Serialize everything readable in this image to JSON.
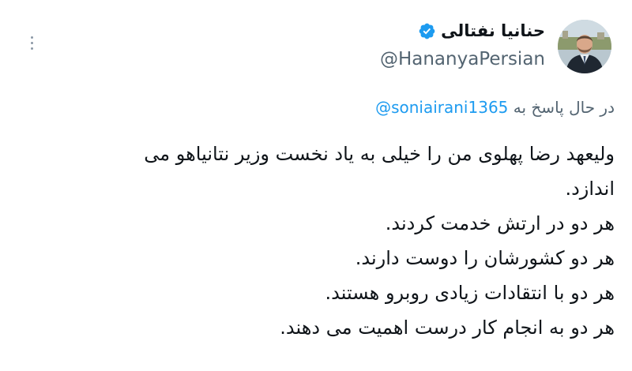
{
  "author": {
    "display_name": "حنانیا نفتالی",
    "handle": "@HananyaPersian",
    "verified": true
  },
  "reply": {
    "prefix": "در حال پاسخ به",
    "mention": "@soniairani1365"
  },
  "tweet_lines": [
    "ولیعهد رضا پهلوی من را خیلی به یاد نخست وزیر نتانیاهو می",
    "اندازد.",
    "هر دو در ارتش خدمت کردند.",
    "هر دو کشورشان را دوست دارند.",
    "هر دو با انتقادات زیادی روبرو هستند.",
    "هر دو به انجام کار درست اهمیت می دهند."
  ],
  "icons": {
    "more": "more-options-icon",
    "verified": "verified-badge-icon"
  },
  "colors": {
    "verified_blue": "#1d9bf0",
    "mention_blue": "#1d9bf0",
    "secondary_text": "#536471",
    "primary_text": "#0f1419"
  }
}
